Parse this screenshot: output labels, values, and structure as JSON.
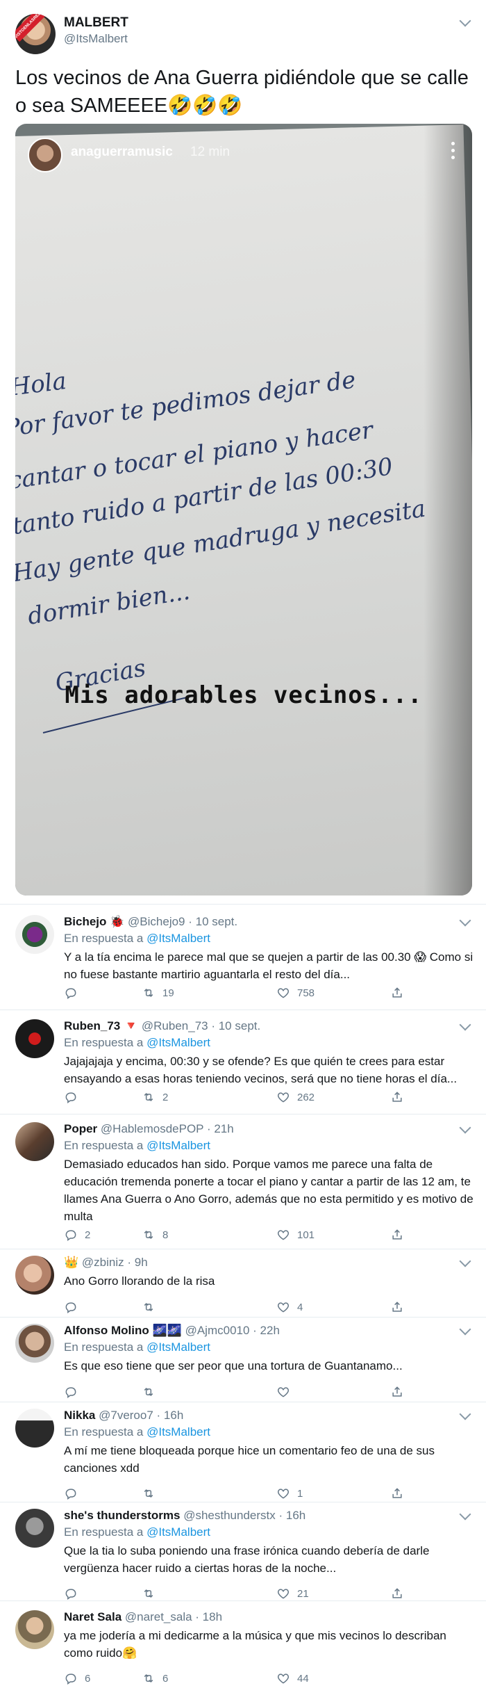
{
  "tweet": {
    "name": "MALBERT",
    "handle": "@ItsMalbert",
    "avatar_text": "VISTOENLASREDES.COM",
    "text": "Los vecinos de Ana Guerra pidiéndole que se calle o sea SAMEEEE🤣🤣🤣",
    "story": {
      "username": "anaguerramusic",
      "time": "12 min",
      "note_lines": [
        "Hola",
        "Por favor te pedimos dejar de",
        "cantar o tocar el piano y hacer",
        "tanto ruido a partir de las 00:30",
        "Hay gente que madruga y necesita",
        "dormir bien...",
        "Gracias"
      ],
      "caption": "Mis adorables vecinos..."
    }
  },
  "reply_prefix": "En respuesta a",
  "reply_to": "@ItsMalbert",
  "replies": [
    {
      "name": "Bichejo",
      "badge": "🐞",
      "handle": "@Bichejo9",
      "time": "· 10 sept.",
      "text": "Y a la tía encima le parece mal que se quejen a partir de las 00.30 😱 Como si no fuese bastante martirio aguantarla el resto del día...",
      "replies": "",
      "retweets": "19",
      "likes": "758"
    },
    {
      "name": "Ruben_73",
      "badge": "🔻",
      "handle": "@Ruben_73",
      "time": "· 10 sept.",
      "text": "Jajajajaja y encima, 00:30 y se ofende? Es que quién te crees para estar ensayando a esas horas teniendo vecinos, será que no tiene horas el día...",
      "replies": "",
      "retweets": "2",
      "likes": "262"
    },
    {
      "name": "Poper",
      "badge": "",
      "handle": "@HablemosdePOP",
      "time": "· 21h",
      "text": "Demasiado educados han sido. Porque vamos me parece una falta de educación tremenda ponerte a tocar el piano y cantar a partir de las 12 am, te llames Ana Guerra o Ano Gorro, además que no esta permitido y es motivo de multa",
      "replies": "2",
      "retweets": "8",
      "likes": "101"
    },
    {
      "name": "",
      "badge": "👑",
      "handle": "@zbiniz",
      "time": "· 9h",
      "text": "Ano Gorro llorando de la risa",
      "replies": "",
      "retweets": "",
      "likes": "4"
    },
    {
      "name": "Alfonso Molino",
      "badge": "🌌🌌",
      "handle": "@Ajmc0010",
      "time": "· 22h",
      "text": "Es que eso tiene que ser peor que una tortura de Guantanamo...",
      "replies": "",
      "retweets": "",
      "likes": ""
    },
    {
      "name": "Nikka",
      "badge": "",
      "handle": "@7veroo7",
      "time": "· 16h",
      "text": "A mí me tiene bloqueada porque hice un comentario feo de una de sus canciones xdd",
      "replies": "",
      "retweets": "",
      "likes": "1"
    },
    {
      "name": "she's thunderstorms",
      "badge": "",
      "handle": "@shesthunderstx",
      "time": "· 16h",
      "text": "Que la tia lo suba poniendo una frase irónica cuando debería de darle vergüenza hacer ruido a ciertas horas de la noche...",
      "replies": "",
      "retweets": "",
      "likes": "21"
    },
    {
      "name": "Naret Sala",
      "badge": "",
      "handle": "@naret_sala",
      "time": "· 18h",
      "text": "ya me jodería a mi dedicarme a la música y que mis vecinos lo describan como ruido🤗",
      "replies": "6",
      "retweets": "6",
      "likes": "44"
    }
  ],
  "colors": {
    "link": "#1b95e0",
    "muted": "#657786",
    "divider": "#e6ecf0"
  }
}
